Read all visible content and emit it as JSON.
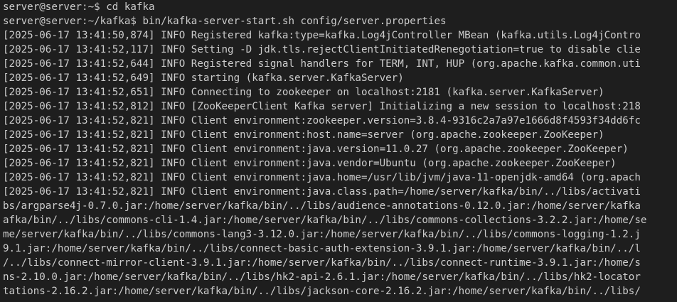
{
  "terminal": {
    "lines": [
      "server@server:~$ cd kafka",
      "server@server:~/kafka$ bin/kafka-server-start.sh config/server.properties",
      "[2025-06-17 13:41:50,874] INFO Registered kafka:type=kafka.Log4jController MBean (kafka.utils.Log4jContro",
      "[2025-06-17 13:41:52,117] INFO Setting -D jdk.tls.rejectClientInitiatedRenegotiation=true to disable clie",
      "[2025-06-17 13:41:52,644] INFO Registered signal handlers for TERM, INT, HUP (org.apache.kafka.common.uti",
      "[2025-06-17 13:41:52,649] INFO starting (kafka.server.KafkaServer)",
      "[2025-06-17 13:41:52,651] INFO Connecting to zookeeper on localhost:2181 (kafka.server.KafkaServer)",
      "[2025-06-17 13:41:52,812] INFO [ZooKeeperClient Kafka server] Initializing a new session to localhost:218",
      "[2025-06-17 13:41:52,821] INFO Client environment:zookeeper.version=3.8.4-9316c2a7a97e1666d8f4593f34dd6fc",
      "[2025-06-17 13:41:52,821] INFO Client environment:host.name=server (org.apache.zookeeper.ZooKeeper)",
      "[2025-06-17 13:41:52,821] INFO Client environment:java.version=11.0.27 (org.apache.zookeeper.ZooKeeper)",
      "[2025-06-17 13:41:52,821] INFO Client environment:java.vendor=Ubuntu (org.apache.zookeeper.ZooKeeper)",
      "[2025-06-17 13:41:52,821] INFO Client environment:java.home=/usr/lib/jvm/java-11-openjdk-amd64 (org.apach",
      "[2025-06-17 13:41:52,821] INFO Client environment:java.class.path=/home/server/kafka/bin/../libs/activati",
      "bs/argparse4j-0.7.0.jar:/home/server/kafka/bin/../libs/audience-annotations-0.12.0.jar:/home/server/kafka",
      "afka/bin/../libs/commons-cli-1.4.jar:/home/server/kafka/bin/../libs/commons-collections-3.2.2.jar:/home/se",
      "me/server/kafka/bin/../libs/commons-lang3-3.12.0.jar:/home/server/kafka/bin/../libs/commons-logging-1.2.j",
      "9.1.jar:/home/server/kafka/bin/../libs/connect-basic-auth-extension-3.9.1.jar:/home/server/kafka/bin/../l",
      "/../libs/connect-mirror-client-3.9.1.jar:/home/server/kafka/bin/../libs/connect-runtime-3.9.1.jar:/home/s",
      "ns-2.10.0.jar:/home/server/kafka/bin/../libs/hk2-api-2.6.1.jar:/home/server/kafka/bin/../libs/hk2-locator",
      "tations-2.16.2.jar:/home/server/kafka/bin/../libs/jackson-core-2.16.2.jar:/home/server/kafka/bin/../libs/"
    ]
  }
}
